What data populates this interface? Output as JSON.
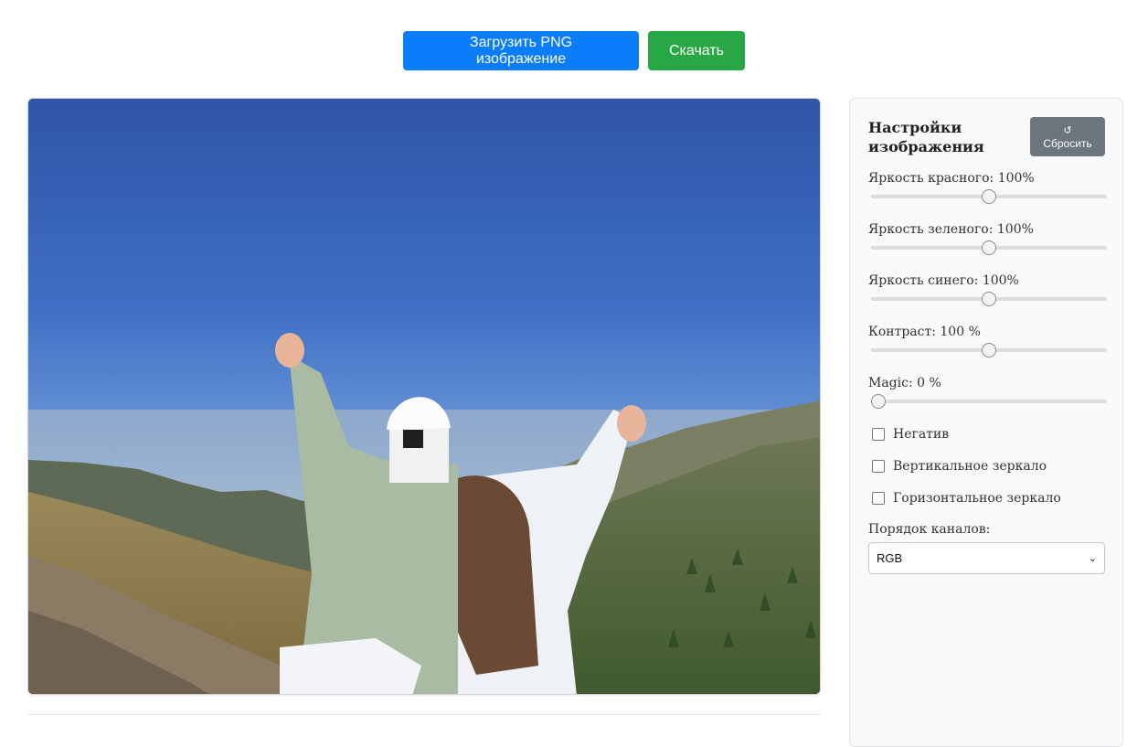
{
  "toolbar": {
    "upload_label": "Загрузить PNG изображение",
    "download_label": "Скачать"
  },
  "panel": {
    "title": "Настройки изображения",
    "reset_icon": "↺",
    "reset_label": "Сбросить",
    "sliders": [
      {
        "label": "Яркость красного: 100%",
        "fraction": 0.5
      },
      {
        "label": "Яркость зеленого: 100%",
        "fraction": 0.5
      },
      {
        "label": "Яркость синего: 100%",
        "fraction": 0.5
      },
      {
        "label": "Контраст: 100 %",
        "fraction": 0.5
      },
      {
        "label": "Magic: 0 %",
        "fraction": 0.0
      }
    ],
    "checkboxes": [
      {
        "label": "Негатив",
        "checked": false
      },
      {
        "label": "Вертикальное зеркало",
        "checked": false
      },
      {
        "label": "Горизонтальное зеркало",
        "checked": false
      }
    ],
    "channel_label": "Порядок каналов:",
    "channel_value": "RGB"
  },
  "colors": {
    "upload_button": "#0b7dfb",
    "download_button": "#28a745",
    "reset_button": "#6c757d",
    "panel_background": "#f8f9fa"
  },
  "icons": {
    "reset": "reset-icon",
    "select": "chevron-down-icon"
  }
}
